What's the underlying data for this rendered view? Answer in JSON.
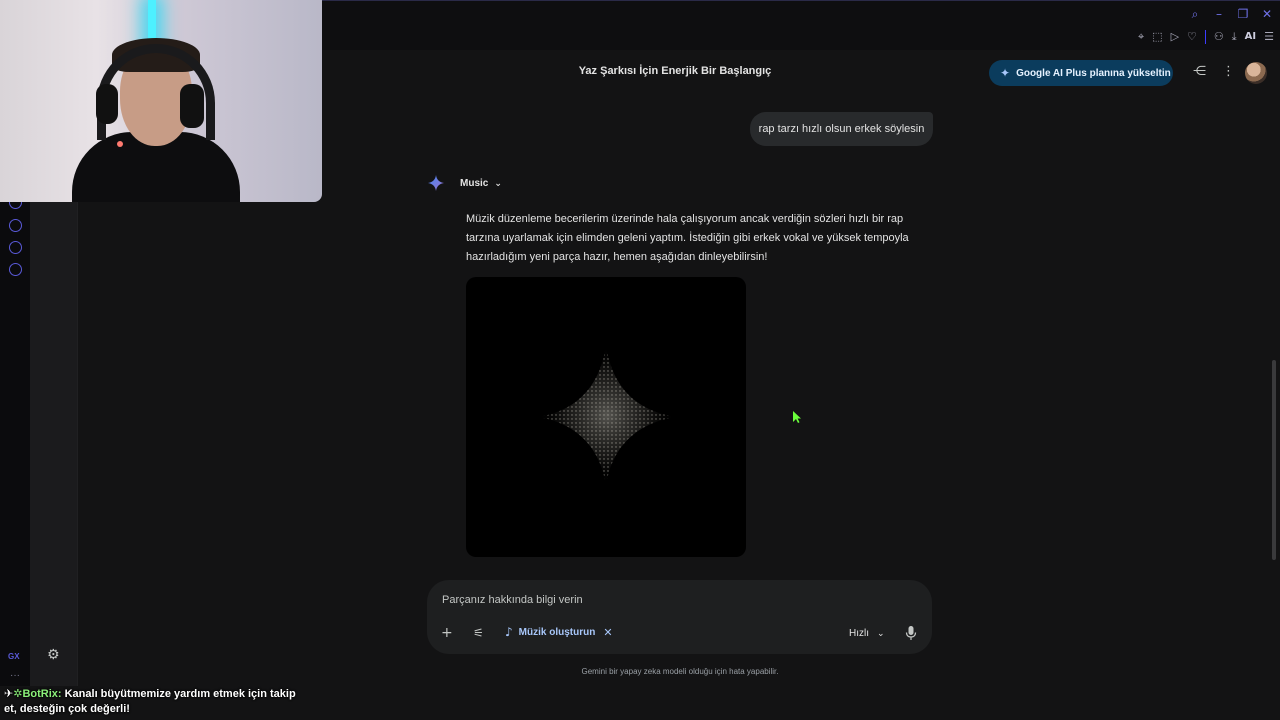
{
  "header": {
    "title": "Yaz Şarkısı İçin Enerjik Bir Başlangıç",
    "upgrade_label": "Google AI Plus planına yükseltin"
  },
  "browser": {
    "ai_label": "AI",
    "gx_label": "GX"
  },
  "chat": {
    "user_message": "rap tarzı hızlı olsun erkek söylesin",
    "model_name": "Music",
    "response_text": "Müzik düzenleme becerilerim üzerinde hala çalışıyorum ancak verdiğin sözleri hızlı bir rap tarzına uyarlamak için elimden geleni yaptım. İstediğin gibi erkek vokal ve yüksek tempoyla hazırladığım yeni parça hazır, hemen aşağıdan dinleyebilirsin!"
  },
  "input": {
    "placeholder": "Parçanız hakkında bilgi verin",
    "tool_chip": "Müzik oluşturun",
    "mode_label": "Hızlı"
  },
  "disclaimer": "Gemini bir yapay zeka modeli olduğu için hata yapabilir.",
  "overlay": {
    "bot_name": "BotRix:",
    "bot_message": "Kanalı büyütmemize yardım etmek için takip et, desteğin çok değerli!"
  },
  "colors": {
    "background": "#131314",
    "upgrade_button": "#0b3c5d",
    "accent_blue": "#a8c7fa",
    "gx_accent": "#5a5ad8"
  }
}
